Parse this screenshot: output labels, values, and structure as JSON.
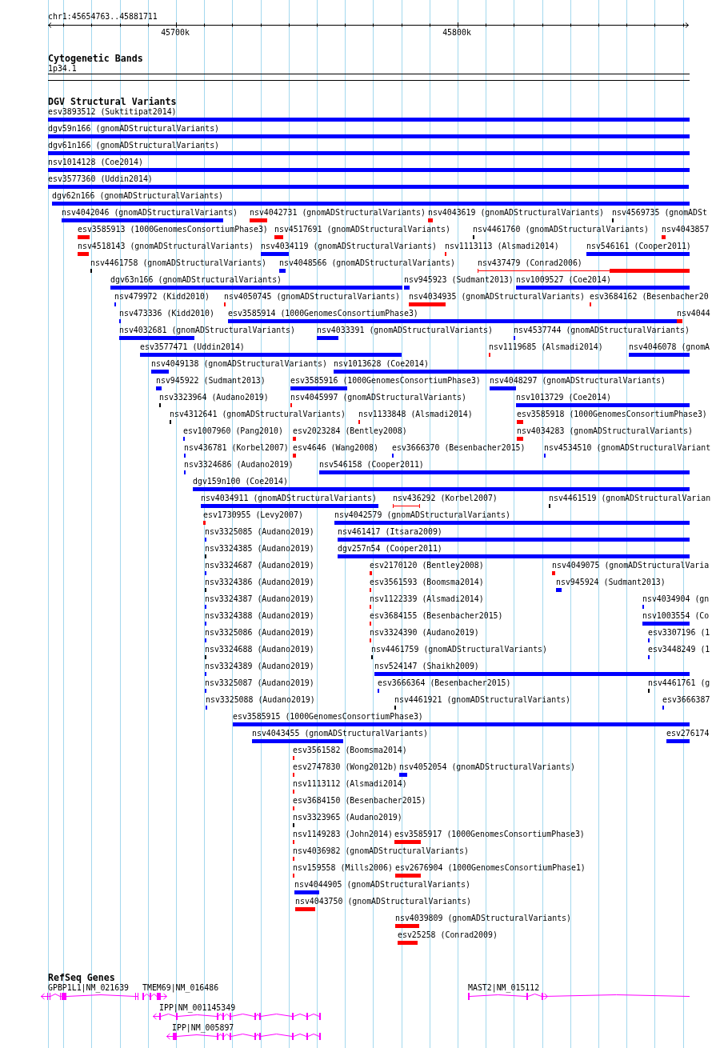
{
  "ruler": {
    "location": "chr1:45654763..45881711",
    "ticks": [
      "45700k",
      "45800k"
    ]
  },
  "cytogenetic_bands": {
    "title": "Cytogenetic Bands",
    "bands": [
      {
        "label": "1p34.1"
      }
    ]
  },
  "dgv_structural_variants": {
    "title": "DGV Structural Variants",
    "rows": [
      {
        "features": [
          {
            "label": "esv3893512 (Suktitipat2014)",
            "kind": "bar",
            "color": "#0000ff"
          }
        ]
      },
      {
        "features": [
          {
            "label": "dgv59n166 (gnomADStructuralVariants)",
            "kind": "bar",
            "color": "#0000ff"
          }
        ]
      },
      {
        "features": [
          {
            "label": "dgv61n166 (gnomADStructuralVariants)",
            "kind": "bar",
            "color": "#0000ff"
          }
        ]
      },
      {
        "features": [
          {
            "label": "nsv1014128 (Coe2014)",
            "kind": "bar",
            "color": "#0000ff"
          }
        ]
      },
      {
        "features": [
          {
            "label": "esv3577360 (Uddin2014)",
            "kind": "bar",
            "color": "#0000ff"
          }
        ]
      },
      {
        "features": [
          {
            "label": "dgv62n166 (gnomADStructuralVariants)",
            "kind": "bar",
            "color": "#0000ff"
          }
        ]
      },
      {
        "features": [
          {
            "label": "nsv4042046 (gnomADStructuralVariants)",
            "kind": "bar",
            "color": "#0000ff"
          },
          {
            "label": "nsv4042731 (gnomADStructuralVariants)",
            "kind": "bar",
            "color": "#ff0000"
          },
          {
            "label": "nsv4043619 (gnomADStructuralVariants)",
            "kind": "bar",
            "color": "#ff0000"
          },
          {
            "label": "nsv4569735 (gnomADSt",
            "kind": "bar",
            "color": "#000000"
          }
        ]
      },
      {
        "features": [
          {
            "label": "esv3585913 (1000GenomesConsortiumPhase3)",
            "kind": "bar",
            "color": "#ff0000"
          },
          {
            "label": "nsv4517691 (gnomADStructuralVariants)",
            "kind": "bar",
            "color": "#ff0000"
          },
          {
            "label": "nsv4461760 (gnomADStructuralVariants)",
            "kind": "bar",
            "color": "#000000"
          },
          {
            "label": "nsv4043857",
            "kind": "bar",
            "color": "#ff0000"
          }
        ]
      },
      {
        "features": [
          {
            "label": "nsv4518143 (gnomADStructuralVariants)",
            "kind": "bar",
            "color": "#ff0000"
          },
          {
            "label": "nsv4034119 (gnomADStructuralVariants)",
            "kind": "bar",
            "color": "#0000ff"
          },
          {
            "label": "nsv1113113 (Alsmadi2014)",
            "kind": "bar",
            "color": "#ff0000"
          },
          {
            "label": "nsv546161 (Cooper2011)",
            "kind": "bar",
            "color": "#0000ff"
          }
        ]
      },
      {
        "features": [
          {
            "label": "nsv4461758 (gnomADStructuralVariants)",
            "kind": "bar",
            "color": "#000000"
          },
          {
            "label": "nsv4048566 (gnomADStructuralVariants)",
            "kind": "bar",
            "color": "#0000ff"
          },
          {
            "label": "nsv437479 (Conrad2006)",
            "kind": "bracket",
            "color": "#ff0000"
          }
        ]
      },
      {
        "features": [
          {
            "label": "dgv63n166 (gnomADStructuralVariants)",
            "kind": "bar",
            "color": "#0000ff"
          },
          {
            "label": "nsv945923 (Sudmant2013)",
            "kind": "bar",
            "color": "#0000ff"
          },
          {
            "label": "nsv1009527 (Coe2014)",
            "kind": "bar",
            "color": "#0000ff"
          }
        ]
      },
      {
        "features": [
          {
            "label": "nsv479972 (Kidd2010)",
            "kind": "bar",
            "color": "#0000ff"
          },
          {
            "label": "nsv4050745 (gnomADStructuralVariants)",
            "kind": "bar",
            "color": "#ff0000"
          },
          {
            "label": "nsv4034935 (gnomADStructuralVariants)",
            "kind": "bar",
            "color": "#ff0000"
          },
          {
            "label": "esv3684162 (Besenbacher20",
            "kind": "bar",
            "color": "#ff0000"
          }
        ]
      },
      {
        "features": [
          {
            "label": "nsv473336 (Kidd2010)",
            "kind": "bar",
            "color": "#0000ff"
          },
          {
            "label": "esv3585914 (1000GenomesConsortiumPhase3)",
            "kind": "bar",
            "color": "#0000ff"
          },
          {
            "label": "nsv4044",
            "kind": "bar",
            "color": "#ff0000"
          }
        ]
      },
      {
        "features": [
          {
            "label": "nsv4032681 (gnomADStructuralVariants)",
            "kind": "bar",
            "color": "#0000ff"
          },
          {
            "label": "nsv4033391 (gnomADStructuralVariants)",
            "kind": "bar",
            "color": "#0000ff"
          },
          {
            "label": "nsv4537744 (gnomADStructuralVariants)",
            "kind": "bar",
            "color": "#0000ff"
          }
        ]
      },
      {
        "features": [
          {
            "label": "esv3577471 (Uddin2014)",
            "kind": "bar",
            "color": "#0000ff"
          },
          {
            "label": "nsv1119685 (Alsmadi2014)",
            "kind": "bar",
            "color": "#ff0000"
          },
          {
            "label": "nsv4046078 (gnomA",
            "kind": "bar",
            "color": "#0000ff"
          }
        ]
      },
      {
        "features": [
          {
            "label": "nsv4049138 (gnomADStructuralVariants)",
            "kind": "bar",
            "color": "#0000ff"
          },
          {
            "label": "nsv1013628 (Coe2014)",
            "kind": "bar",
            "color": "#0000ff"
          }
        ]
      },
      {
        "features": [
          {
            "label": "nsv945922 (Sudmant2013)",
            "kind": "bar",
            "color": "#0000ff"
          },
          {
            "label": "esv3585916 (1000GenomesConsortiumPhase3)",
            "kind": "bar",
            "color": "#0000ff"
          },
          {
            "label": "nsv4048297 (gnomADStructuralVariants)",
            "kind": "bar",
            "color": "#0000ff"
          }
        ]
      },
      {
        "features": [
          {
            "label": "nsv3323964 (Audano2019)",
            "kind": "bar",
            "color": "#000000"
          },
          {
            "label": "nsv4045997 (gnomADStructuralVariants)",
            "kind": "bar",
            "color": "#ff0000"
          },
          {
            "label": "nsv1013729 (Coe2014)",
            "kind": "bar",
            "color": "#0000ff"
          }
        ]
      },
      {
        "features": [
          {
            "label": "nsv4312641 (gnomADStructuralVariants)",
            "kind": "bar",
            "color": "#000000"
          },
          {
            "label": "nsv1133848 (Alsmadi2014)",
            "kind": "bar",
            "color": "#ff0000"
          },
          {
            "label": "esv3585918 (1000GenomesConsortiumPhase3)",
            "kind": "bar",
            "color": "#ff0000"
          }
        ]
      },
      {
        "features": [
          {
            "label": "esv1007960 (Pang2010)",
            "kind": "bar",
            "color": "#0000ff"
          },
          {
            "label": "esv2023284 (Bentley2008)",
            "kind": "bar",
            "color": "#ff0000"
          },
          {
            "label": "nsv4034283 (gnomADStructuralVariants)",
            "kind": "bar",
            "color": "#ff0000"
          }
        ]
      },
      {
        "features": [
          {
            "label": "nsv436781 (Korbel2007)",
            "kind": "bar",
            "color": "#0000ff"
          },
          {
            "label": "esv4646 (Wang2008)",
            "kind": "bar",
            "color": "#ff0000"
          },
          {
            "label": "esv3666370 (Besenbacher2015)",
            "kind": "bar",
            "color": "#0000ff"
          },
          {
            "label": "nsv4534510 (gnomADStructuralVariant",
            "kind": "bar",
            "color": "#0000ff"
          }
        ]
      },
      {
        "features": [
          {
            "label": "nsv3324686 (Audano2019)",
            "kind": "bar",
            "color": "#0000ff"
          },
          {
            "label": "nsv546158 (Cooper2011)",
            "kind": "bar",
            "color": "#0000ff"
          }
        ]
      },
      {
        "features": [
          {
            "label": "dgv159n100 (Coe2014)",
            "kind": "bar",
            "color": "#0000ff"
          }
        ]
      },
      {
        "features": [
          {
            "label": "nsv4034911 (gnomADStructuralVariants)",
            "kind": "bar",
            "color": "#0000ff"
          },
          {
            "label": "nsv436292 (Korbel2007)",
            "kind": "bracket",
            "color": "#ff0000"
          },
          {
            "label": "nsv4461519 (gnomADStructuralVarian",
            "kind": "bar",
            "color": "#000000"
          }
        ]
      },
      {
        "features": [
          {
            "label": "esv1730955 (Levy2007)",
            "kind": "bar",
            "color": "#ff0000"
          },
          {
            "label": "nsv4042579 (gnomADStructuralVariants)",
            "kind": "bar",
            "color": "#0000ff"
          }
        ]
      },
      {
        "features": [
          {
            "label": "nsv3325085 (Audano2019)",
            "kind": "bar",
            "color": "#0000ff"
          },
          {
            "label": "nsv461417 (Itsara2009)",
            "kind": "bar",
            "color": "#0000ff"
          }
        ]
      },
      {
        "features": [
          {
            "label": "nsv3324385 (Audano2019)",
            "kind": "bar",
            "color": "#000000"
          },
          {
            "label": "dgv257n54 (Cooper2011)",
            "kind": "bar",
            "color": "#0000ff"
          }
        ]
      },
      {
        "features": [
          {
            "label": "nsv3324687 (Audano2019)",
            "kind": "bar",
            "color": "#0000ff"
          },
          {
            "label": "esv2170120 (Bentley2008)",
            "kind": "bar",
            "color": "#ff0000"
          },
          {
            "label": "nsv4049075 (gnomADStructuralVaria",
            "kind": "bar",
            "color": "#ff0000"
          }
        ]
      },
      {
        "features": [
          {
            "label": "nsv3324386 (Audano2019)",
            "kind": "bar",
            "color": "#000000"
          },
          {
            "label": "esv3561593 (Boomsma2014)",
            "kind": "bar",
            "color": "#ff0000"
          },
          {
            "label": "nsv945924 (Sudmant2013)",
            "kind": "bar",
            "color": "#0000ff"
          }
        ]
      },
      {
        "features": [
          {
            "label": "nsv3324387 (Audano2019)",
            "kind": "bar",
            "color": "#0000ff"
          },
          {
            "label": "nsv1122339 (Alsmadi2014)",
            "kind": "bar",
            "color": "#ff0000"
          },
          {
            "label": "nsv4034904 (gn",
            "kind": "bar",
            "color": "#0000ff"
          }
        ]
      },
      {
        "features": [
          {
            "label": "nsv3324388 (Audano2019)",
            "kind": "bar",
            "color": "#0000ff"
          },
          {
            "label": "esv3684155 (Besenbacher2015)",
            "kind": "bar",
            "color": "#ff0000"
          },
          {
            "label": "nsv1003554 (Co",
            "kind": "bar",
            "color": "#0000ff"
          }
        ]
      },
      {
        "features": [
          {
            "label": "nsv3325086 (Audano2019)",
            "kind": "bar",
            "color": "#0000ff"
          },
          {
            "label": "nsv3324390 (Audano2019)",
            "kind": "bar",
            "color": "#ff0000"
          },
          {
            "label": "esv3307196 (1",
            "kind": "bar",
            "color": "#0000ff"
          }
        ]
      },
      {
        "features": [
          {
            "label": "nsv3324688 (Audano2019)",
            "kind": "bar",
            "color": "#000000"
          },
          {
            "label": "nsv4461759 (gnomADStructuralVariants)",
            "kind": "bar",
            "color": "#000000"
          },
          {
            "label": "esv3448249 (1",
            "kind": "bar",
            "color": "#0000ff"
          }
        ]
      },
      {
        "features": [
          {
            "label": "nsv3324389 (Audano2019)",
            "kind": "bar",
            "color": "#0000ff"
          },
          {
            "label": "nsv524147 (Shaikh2009)",
            "kind": "bar",
            "color": "#0000ff"
          }
        ]
      },
      {
        "features": [
          {
            "label": "nsv3325087 (Audano2019)",
            "kind": "bar",
            "color": "#0000ff"
          },
          {
            "label": "esv3666364 (Besenbacher2015)",
            "kind": "bar",
            "color": "#0000ff"
          },
          {
            "label": "nsv4461761 (g",
            "kind": "bar",
            "color": "#000000"
          }
        ]
      },
      {
        "features": [
          {
            "label": "nsv3325088 (Audano2019)",
            "kind": "bar",
            "color": "#0000ff"
          },
          {
            "label": "nsv4461921 (gnomADStructuralVariants)",
            "kind": "bar",
            "color": "#000000"
          },
          {
            "label": "esv3666387",
            "kind": "bar",
            "color": "#0000ff"
          }
        ]
      },
      {
        "features": [
          {
            "label": "esv3585915 (1000GenomesConsortiumPhase3)",
            "kind": "bar",
            "color": "#0000ff"
          }
        ]
      },
      {
        "features": [
          {
            "label": "nsv4043455 (gnomADStructuralVariants)",
            "kind": "bar",
            "color": "#0000ff"
          },
          {
            "label": "esv276174",
            "kind": "bar",
            "color": "#0000ff"
          }
        ]
      },
      {
        "features": [
          {
            "label": "esv3561582 (Boomsma2014)",
            "kind": "bar",
            "color": "#ff0000"
          }
        ]
      },
      {
        "features": [
          {
            "label": "esv2747830 (Wong2012b)",
            "kind": "bar",
            "color": "#ff0000"
          },
          {
            "label": "nsv4052054 (gnomADStructuralVariants)",
            "kind": "bar",
            "color": "#0000ff"
          }
        ]
      },
      {
        "features": [
          {
            "label": "nsv1113112 (Alsmadi2014)",
            "kind": "bar",
            "color": "#ff0000"
          }
        ]
      },
      {
        "features": [
          {
            "label": "esv3684150 (Besenbacher2015)",
            "kind": "bar",
            "color": "#ff0000"
          }
        ]
      },
      {
        "features": [
          {
            "label": "nsv3323965 (Audano2019)",
            "kind": "bar",
            "color": "#000000"
          }
        ]
      },
      {
        "features": [
          {
            "label": "nsv1149283 (John2014)",
            "kind": "bar",
            "color": "#ff0000"
          },
          {
            "label": "esv3585917 (1000GenomesConsortiumPhase3)",
            "kind": "bar",
            "color": "#ff0000"
          }
        ]
      },
      {
        "features": [
          {
            "label": "nsv4036982 (gnomADStructuralVariants)",
            "kind": "bar",
            "color": "#ff0000"
          }
        ]
      },
      {
        "features": [
          {
            "label": "nsv159558 (Mills2006)",
            "kind": "bar",
            "color": "#ff0000"
          },
          {
            "label": "esv2676904 (1000GenomesConsortiumPhase1)",
            "kind": "bar",
            "color": "#ff0000"
          }
        ]
      },
      {
        "features": [
          {
            "label": "nsv4044905 (gnomADStructuralVariants)",
            "kind": "bar",
            "color": "#0000ff"
          }
        ]
      },
      {
        "features": [
          {
            "label": "nsv4043750 (gnomADStructuralVariants)",
            "kind": "bar",
            "color": "#ff0000"
          }
        ]
      },
      {
        "features": [
          {
            "label": "nsv4039809 (gnomADStructuralVariants)",
            "kind": "bar",
            "color": "#ff0000"
          }
        ]
      },
      {
        "features": [
          {
            "label": "esv25258 (Conrad2009)",
            "kind": "bar",
            "color": "#ff0000"
          }
        ]
      }
    ]
  },
  "refseq_genes": {
    "title": "RefSeq Genes",
    "rows": [
      {
        "genes": [
          {
            "label": "GPBP1L1|NM_021639",
            "reverse_strand": true
          },
          {
            "label": "TMEM69|NM_016486",
            "reverse_strand": false
          },
          {
            "label": "MAST2|NM_015112",
            "reverse_strand": false
          }
        ]
      },
      {
        "genes": [
          {
            "label": "IPP|NM_001145349",
            "reverse_strand": true
          }
        ]
      },
      {
        "genes": [
          {
            "label": "IPP|NM_005897",
            "reverse_strand": true
          }
        ]
      }
    ]
  }
}
